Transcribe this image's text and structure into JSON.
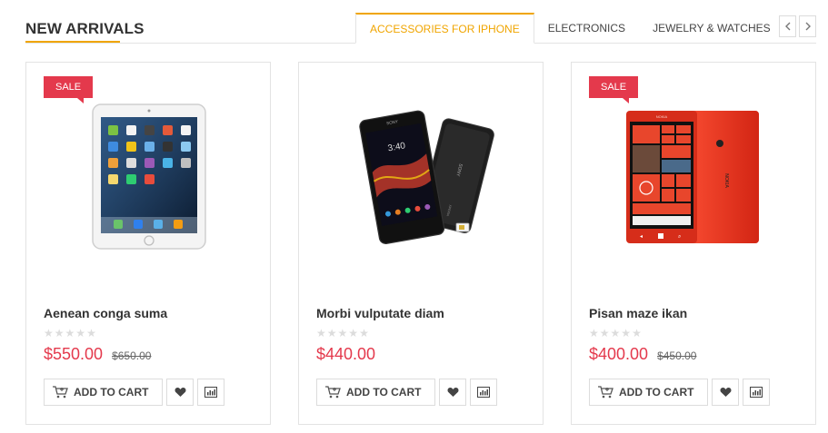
{
  "section": {
    "title": "NEW ARRIVALS",
    "accent_color": "#f0a500"
  },
  "tabs": [
    {
      "label": "ACCESSORIES FOR IPHONE",
      "active": true
    },
    {
      "label": "ELECTRONICS",
      "active": false
    },
    {
      "label": "JEWELRY & WATCHES",
      "active": false
    }
  ],
  "nav": {
    "prev_icon": "chevron-left-icon",
    "next_icon": "chevron-right-icon"
  },
  "products": [
    {
      "badge": "SALE",
      "image": "tablet-image",
      "name": "Aenean conga suma",
      "rating": 0,
      "price": "$550.00",
      "old_price": "$650.00",
      "cart_label": "ADD TO CART"
    },
    {
      "badge": "",
      "image": "phone-black-image",
      "name": "Morbi vulputate diam",
      "rating": 0,
      "price": "$440.00",
      "old_price": "",
      "cart_label": "ADD TO CART"
    },
    {
      "badge": "SALE",
      "image": "phone-red-image",
      "name": "Pisan maze ikan",
      "rating": 0,
      "price": "$400.00",
      "old_price": "$450.00",
      "cart_label": "ADD TO CART"
    }
  ],
  "colors": {
    "sale": "#e4394c",
    "price": "#e4394c",
    "accent": "#f0a500",
    "border": "#e3e3e3"
  }
}
